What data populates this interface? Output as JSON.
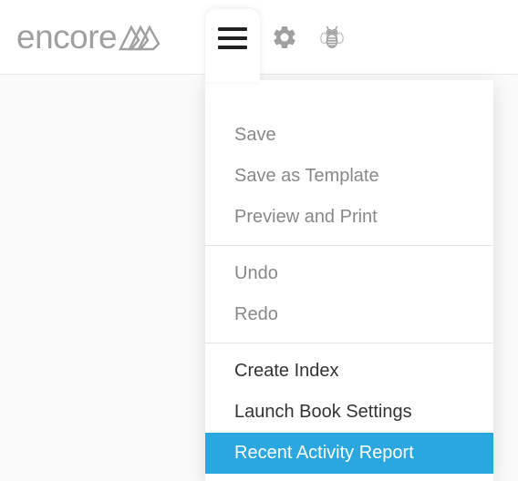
{
  "brand": {
    "name": "encore"
  },
  "toolbar": {
    "hamburger": "menu-icon",
    "gear": "settings-icon",
    "bee": "bee-icon"
  },
  "menu": {
    "group1": [
      {
        "label": "Save"
      },
      {
        "label": "Save as Template"
      },
      {
        "label": "Preview and Print"
      }
    ],
    "group2": [
      {
        "label": "Undo"
      },
      {
        "label": "Redo"
      }
    ],
    "group3": [
      {
        "label": "Create Index"
      },
      {
        "label": "Launch Book Settings"
      },
      {
        "label": "Recent Activity Report",
        "highlighted": true
      }
    ]
  }
}
